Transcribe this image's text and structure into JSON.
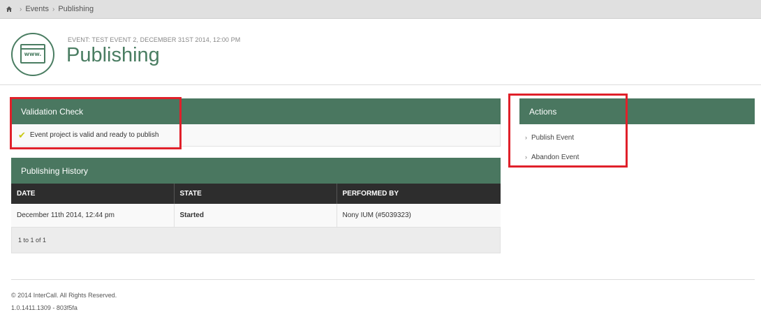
{
  "breadcrumb": {
    "home_icon": "home-icon",
    "items": [
      "Events",
      "Publishing"
    ]
  },
  "header": {
    "logo_text": "www.",
    "event_meta": "EVENT: TEST EVENT 2, DECEMBER 31ST 2014, 12:00 PM",
    "title": "Publishing"
  },
  "validation": {
    "title": "Validation Check",
    "message": "Event project is valid and ready to publish",
    "status_icon": "check-icon"
  },
  "history": {
    "title": "Publishing History",
    "columns": [
      "DATE",
      "STATE",
      "PERFORMED BY"
    ],
    "rows": [
      [
        "December 11th 2014, 12:44 pm",
        "Started",
        "Nony IUM (#5039323)"
      ]
    ],
    "pager": "1 to 1 of 1"
  },
  "actions": {
    "title": "Actions",
    "items": [
      "Publish Event",
      "Abandon Event"
    ]
  },
  "footer": {
    "copyright": "© 2014 InterCall. All Rights Reserved.",
    "version": "1.0.1411.1309 - 803f5fa"
  },
  "colors": {
    "panel_header": "#4a7760",
    "table_header": "#2d2d2d",
    "highlight": "#e0202a",
    "check": "#c9c912"
  }
}
